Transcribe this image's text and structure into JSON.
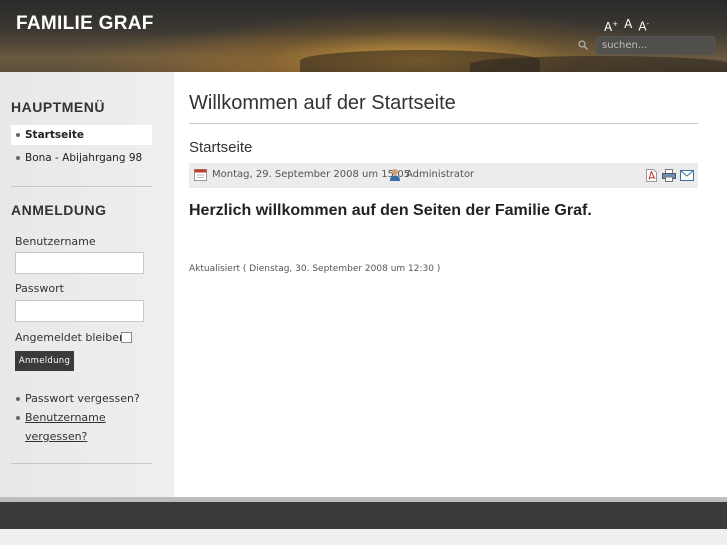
{
  "header": {
    "site_title": "FAMILIE GRAF",
    "font_increase": "A",
    "font_increase_sup": "+",
    "font_reset": "A",
    "font_decrease": "A",
    "font_decrease_sup": "-",
    "search_placeholder": "suchen..."
  },
  "sidebar": {
    "main_menu_title": "HAUPTMENÜ",
    "menu_items": [
      {
        "label": "Startseite",
        "active": true
      },
      {
        "label": "Bona - Abijahrgang 98",
        "active": false
      }
    ],
    "login_title": "ANMELDUNG",
    "username_label": "Benutzername",
    "password_label": "Passwort",
    "remember_label": "Angemeldet bleiben",
    "login_button": "Anmeldung",
    "forgot_password": "Passwort vergessen?",
    "forgot_username_line1": "Benutzername",
    "forgot_username_line2": "vergessen?"
  },
  "main": {
    "heading": "Willkommen auf der Startseite",
    "article_title": "Startseite",
    "meta_date": "Montag, 29. September 2008 um 15:05",
    "meta_author": "Administrator",
    "welcome_text": "Herzlich willkommen auf den Seiten der Familie Graf.",
    "updated_text": "Aktualisiert ( Dienstag, 30. September 2008 um 12:30 )"
  },
  "colors": {
    "header_dark": "#2a2a2a",
    "header_sunset": "#d7a03c",
    "sidebar_bg": "#ececec",
    "footer_bg": "#3a3a3a",
    "button_bg": "#3a3a3a"
  },
  "icons": [
    "search-icon",
    "calendar-icon",
    "user-icon",
    "pdf-icon",
    "print-icon",
    "email-icon"
  ]
}
